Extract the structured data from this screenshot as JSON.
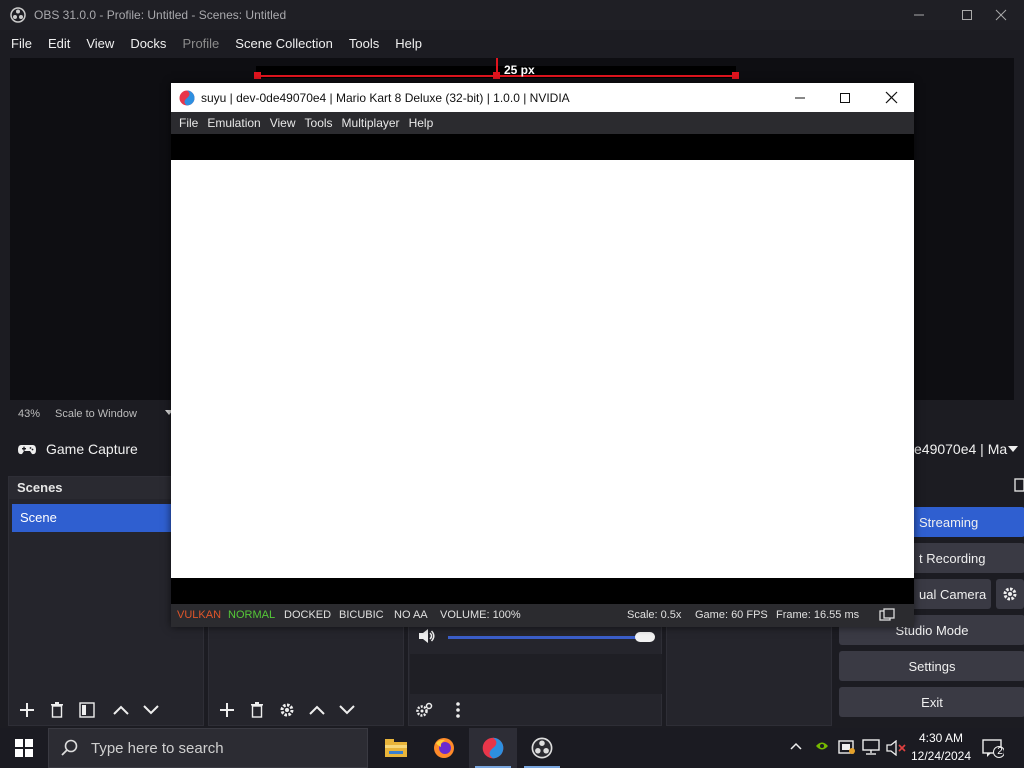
{
  "obs": {
    "title": "OBS 31.0.0 - Profile: Untitled - Scenes: Untitled",
    "menu": [
      "File",
      "Edit",
      "View",
      "Docks",
      "Profile",
      "Scene Collection",
      "Tools",
      "Help"
    ],
    "measure_label": "25 px",
    "zoom_percent": "43%",
    "zoom_mode": "Scale to Window",
    "source_name": "Game Capture",
    "window_selector": "e49070e4 | Ma",
    "scenes_title": "Scenes",
    "scene_item": "Scene",
    "controls": {
      "streaming": "Streaming",
      "recording": "t Recording",
      "virtual_camera": "ual Camera",
      "studio_mode": "Studio Mode",
      "settings": "Settings",
      "exit": "Exit"
    }
  },
  "suyu": {
    "title": "suyu | dev-0de49070e4 | Mario Kart 8 Deluxe (32-bit) | 1.0.0 | NVIDIA",
    "menu": [
      "File",
      "Emulation",
      "View",
      "Tools",
      "Multiplayer",
      "Help"
    ],
    "status": {
      "api": "VULKAN",
      "speed": "NORMAL",
      "dock": "DOCKED",
      "filter": "BICUBIC",
      "aa": "NO AA",
      "volume": "VOLUME: 100%",
      "scale": "Scale: 0.5x",
      "fps": "Game: 60 FPS",
      "frame": "Frame: 16.55 ms"
    },
    "colors": {
      "api": "#e0552a",
      "speed": "#55c838"
    }
  },
  "taskbar": {
    "search_placeholder": "Type here to search",
    "time": "4:30 AM",
    "date": "12/24/2024",
    "notifications": "2"
  }
}
